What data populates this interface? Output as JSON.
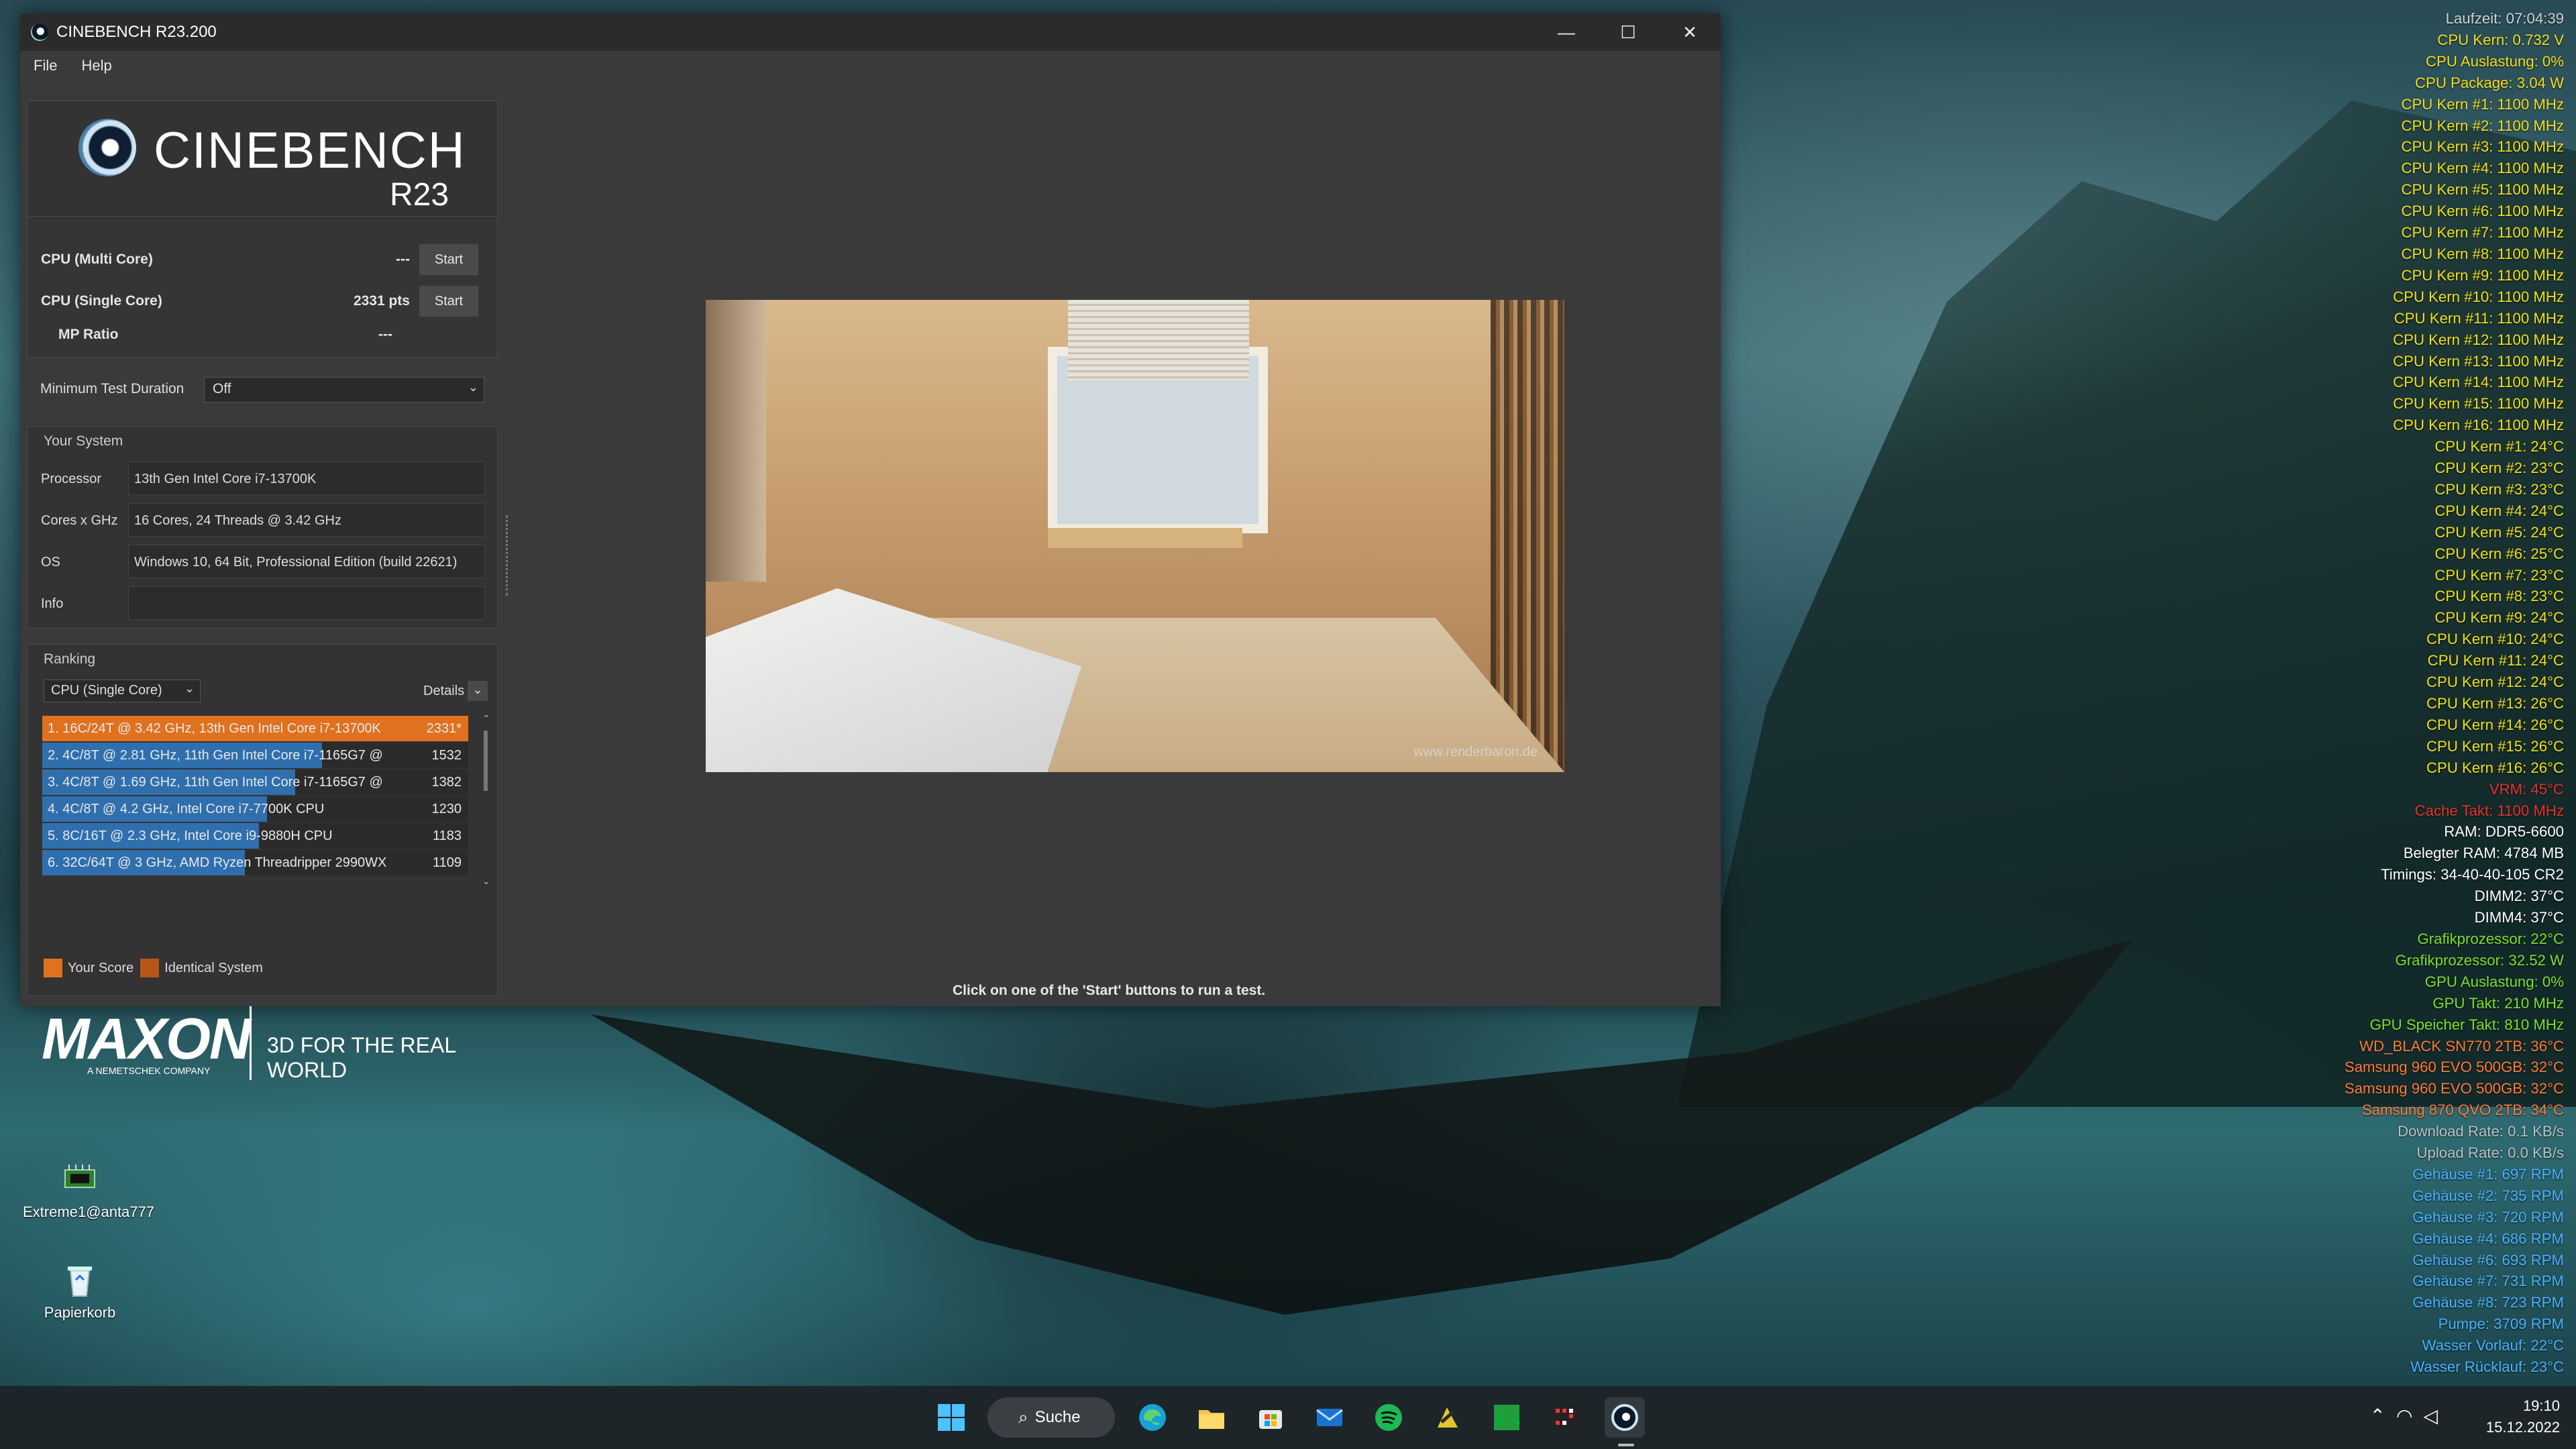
{
  "window": {
    "title": "CINEBENCH R23.200",
    "controls": {
      "minimize": "—",
      "maximize": "☐",
      "close": "✕"
    }
  },
  "menu": {
    "file": "File",
    "help": "Help"
  },
  "logo": {
    "word": "CINEBENCH",
    "version": "R23"
  },
  "bench": {
    "multi_label": "CPU (Multi Core)",
    "multi_value": "---",
    "single_label": "CPU (Single Core)",
    "single_value": "2331 pts",
    "mp_label": "MP Ratio",
    "mp_value": "---",
    "start_label": "Start"
  },
  "min_duration": {
    "label": "Minimum Test Duration",
    "value": "Off"
  },
  "system": {
    "title": "Your System",
    "rows": [
      {
        "label": "Processor",
        "value": "13th Gen Intel Core i7-13700K"
      },
      {
        "label": "Cores x GHz",
        "value": "16 Cores, 24 Threads @ 3.42 GHz"
      },
      {
        "label": "OS",
        "value": "Windows 10, 64 Bit, Professional Edition (build 22621)"
      },
      {
        "label": "Info",
        "value": ""
      }
    ]
  },
  "ranking": {
    "title": "Ranking",
    "mode": "CPU (Single Core)",
    "details": "Details",
    "rows": [
      {
        "text": "1. 16C/24T @ 3.42 GHz, 13th Gen Intel Core i7-13700K",
        "score": "2331*",
        "fraction": 1.0,
        "mine": true
      },
      {
        "text": "2. 4C/8T @ 2.81 GHz, 11th Gen Intel Core i7-1165G7 @",
        "score": "1532",
        "fraction": 0.657
      },
      {
        "text": "3. 4C/8T @ 1.69 GHz, 11th Gen Intel Core i7-1165G7 @",
        "score": "1382",
        "fraction": 0.593
      },
      {
        "text": "4. 4C/8T @ 4.2 GHz, Intel Core i7-7700K CPU",
        "score": "1230",
        "fraction": 0.528
      },
      {
        "text": "5. 8C/16T @ 2.3 GHz, Intel Core i9-9880H CPU",
        "score": "1183",
        "fraction": 0.508
      },
      {
        "text": "6. 32C/64T @ 3 GHz, AMD Ryzen Threadripper 2990WX",
        "score": "1109",
        "fraction": 0.476
      }
    ],
    "legend_your": "Your Score",
    "legend_identical": "Identical System"
  },
  "brand": {
    "maxon": "MAXON",
    "sub": "A NEMETSCHEK COMPANY",
    "tagline": "3D FOR THE REAL WORLD"
  },
  "render": {
    "watermark": "www.renderbaron.de"
  },
  "hint": "Click on one of the 'Start' buttons to run a test.",
  "desktop_icons": [
    {
      "label": "Extreme1@anta777"
    },
    {
      "label": "Papierkorb"
    }
  ],
  "osd": [
    {
      "t": "Laufzeit: 07:04:39",
      "c": "#cfd6d8"
    },
    {
      "t": "CPU Kern: 0.732 V",
      "c": "#f0e020"
    },
    {
      "t": "CPU Auslastung: 0%",
      "c": "#f0e020"
    },
    {
      "t": "CPU Package: 3.04 W",
      "c": "#f0e020"
    },
    {
      "t": "CPU Kern #1: 1100 MHz",
      "c": "#f0e020"
    },
    {
      "t": "CPU Kern #2: 1100 MHz",
      "c": "#f0e020"
    },
    {
      "t": "CPU Kern #3: 1100 MHz",
      "c": "#f0e020"
    },
    {
      "t": "CPU Kern #4: 1100 MHz",
      "c": "#f0e020"
    },
    {
      "t": "CPU Kern #5: 1100 MHz",
      "c": "#f0e020"
    },
    {
      "t": "CPU Kern #6: 1100 MHz",
      "c": "#f0e020"
    },
    {
      "t": "CPU Kern #7: 1100 MHz",
      "c": "#f0e020"
    },
    {
      "t": "CPU Kern #8: 1100 MHz",
      "c": "#f0e020"
    },
    {
      "t": "CPU Kern #9: 1100 MHz",
      "c": "#f0e020"
    },
    {
      "t": "CPU Kern #10: 1100 MHz",
      "c": "#f0e020"
    },
    {
      "t": "CPU Kern #11: 1100 MHz",
      "c": "#f0e020"
    },
    {
      "t": "CPU Kern #12: 1100 MHz",
      "c": "#f0e020"
    },
    {
      "t": "CPU Kern #13: 1100 MHz",
      "c": "#f0e020"
    },
    {
      "t": "CPU Kern #14: 1100 MHz",
      "c": "#f0e020"
    },
    {
      "t": "CPU Kern #15: 1100 MHz",
      "c": "#f0e020"
    },
    {
      "t": "CPU Kern #16: 1100 MHz",
      "c": "#f0e020"
    },
    {
      "t": "CPU Kern #1: 24°C",
      "c": "#f0e020"
    },
    {
      "t": "CPU Kern #2: 23°C",
      "c": "#f0e020"
    },
    {
      "t": "CPU Kern #3: 23°C",
      "c": "#f0e020"
    },
    {
      "t": "CPU Kern #4: 24°C",
      "c": "#f0e020"
    },
    {
      "t": "CPU Kern #5: 24°C",
      "c": "#f0e020"
    },
    {
      "t": "CPU Kern #6: 25°C",
      "c": "#f0e020"
    },
    {
      "t": "CPU Kern #7: 23°C",
      "c": "#f0e020"
    },
    {
      "t": "CPU Kern #8: 23°C",
      "c": "#f0e020"
    },
    {
      "t": "CPU Kern #9: 24°C",
      "c": "#f0e020"
    },
    {
      "t": "CPU Kern #10: 24°C",
      "c": "#f0e020"
    },
    {
      "t": "CPU Kern #11: 24°C",
      "c": "#f0e020"
    },
    {
      "t": "CPU Kern #12: 24°C",
      "c": "#f0e020"
    },
    {
      "t": "CPU Kern #13: 26°C",
      "c": "#f0e020"
    },
    {
      "t": "CPU Kern #14: 26°C",
      "c": "#f0e020"
    },
    {
      "t": "CPU Kern #15: 26°C",
      "c": "#f0e020"
    },
    {
      "t": "CPU Kern #16: 26°C",
      "c": "#f0e020"
    },
    {
      "t": "VRM: 45°C",
      "c": "#e8322c"
    },
    {
      "t": "Cache Takt: 1100 MHz",
      "c": "#e8322c"
    },
    {
      "t": "RAM: DDR5-6600",
      "c": "#ffffff"
    },
    {
      "t": "Belegter RAM: 4784 MB",
      "c": "#ffffff"
    },
    {
      "t": "Timings: 34-40-40-105 CR2",
      "c": "#ffffff"
    },
    {
      "t": "DIMM2: 37°C",
      "c": "#ffffff"
    },
    {
      "t": "DIMM4: 37°C",
      "c": "#ffffff"
    },
    {
      "t": "Grafikprozessor: 22°C",
      "c": "#7be030"
    },
    {
      "t": "Grafikprozessor: 32.52 W",
      "c": "#7be030"
    },
    {
      "t": "GPU Auslastung: 0%",
      "c": "#7be030"
    },
    {
      "t": "GPU Takt: 210 MHz",
      "c": "#7be030"
    },
    {
      "t": "GPU Speicher Takt: 810 MHz",
      "c": "#7be030"
    },
    {
      "t": "WD_BLACK SN770 2TB: 36°C",
      "c": "#ff7a3a"
    },
    {
      "t": "Samsung 960 EVO 500GB: 32°C",
      "c": "#ff7a3a"
    },
    {
      "t": "Samsung 960 EVO 500GB: 32°C",
      "c": "#ff7a3a"
    },
    {
      "t": "Samsung 870 QVO 2TB: 34°C",
      "c": "#ff7a3a"
    },
    {
      "t": "Download Rate: 0.1 KB/s",
      "c": "#b9c4c8"
    },
    {
      "t": "Upload Rate: 0.0 KB/s",
      "c": "#b9c4c8"
    },
    {
      "t": "Gehäuse #1: 697 RPM",
      "c": "#49b3ff"
    },
    {
      "t": "Gehäuse #2: 735 RPM",
      "c": "#49b3ff"
    },
    {
      "t": "Gehäuse #3: 720 RPM",
      "c": "#49b3ff"
    },
    {
      "t": "Gehäuse #4: 686 RPM",
      "c": "#49b3ff"
    },
    {
      "t": "Gehäuse #6: 693 RPM",
      "c": "#49b3ff"
    },
    {
      "t": "Gehäuse #7: 731 RPM",
      "c": "#49b3ff"
    },
    {
      "t": "Gehäuse #8: 723 RPM",
      "c": "#49b3ff"
    },
    {
      "t": "Pumpe: 3709 RPM",
      "c": "#49b3ff"
    },
    {
      "t": "Wasser Vorlauf: 22°C",
      "c": "#49b3ff"
    },
    {
      "t": "Wasser Rücklauf: 23°C",
      "c": "#49b3ff"
    }
  ],
  "taskbar": {
    "search_label": "Suche",
    "time": "19:10",
    "date": "15.12.2022",
    "apps": [
      "windows-start-icon",
      "edge-icon",
      "file-explorer-icon",
      "store-icon",
      "mail-icon",
      "spotify-icon",
      "app-icon",
      "app-icon",
      "app-icon",
      "cinebench-icon"
    ]
  }
}
